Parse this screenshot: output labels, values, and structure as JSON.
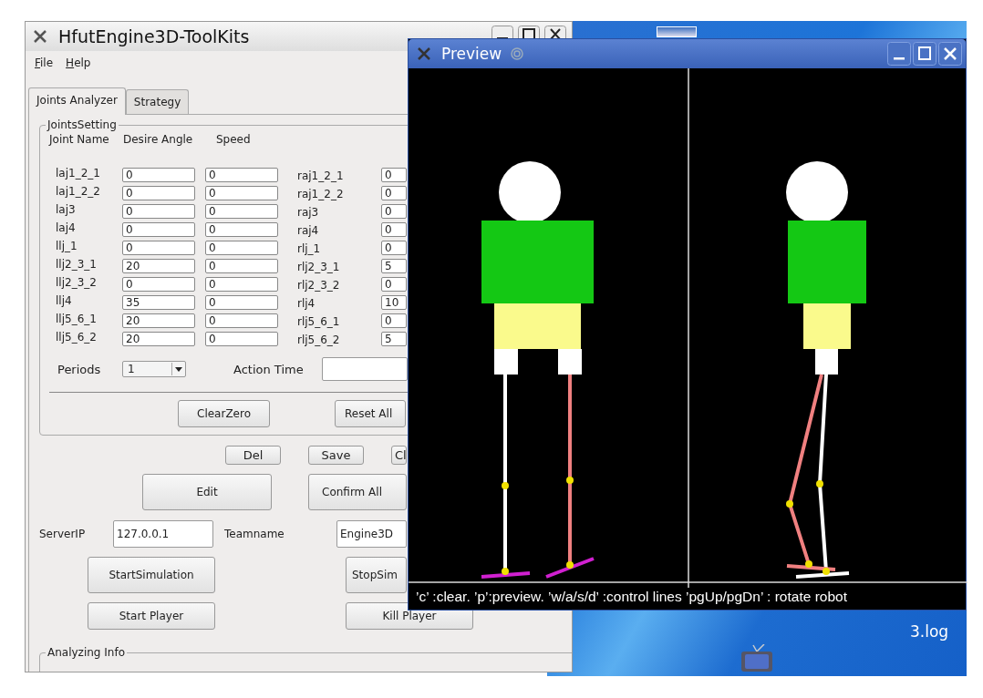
{
  "main_window": {
    "title": "HfutEngine3D-ToolKits",
    "menu": [
      "File",
      "Help"
    ],
    "tabs": [
      {
        "label": "Joints Analyzer",
        "selected": true
      },
      {
        "label": "Strategy",
        "selected": false
      }
    ],
    "joints_setting": {
      "title": "JointsSetting",
      "columns": [
        "Joint Name",
        "Desire Angle",
        "Speed"
      ],
      "rows": [
        {
          "name": "laj1_2_1",
          "angle": "0",
          "speed": "0",
          "right_name": "raj1_2_1",
          "right_value": "0"
        },
        {
          "name": "laj1_2_2",
          "angle": "0",
          "speed": "0",
          "right_name": "raj1_2_2",
          "right_value": "0"
        },
        {
          "name": "laj3",
          "angle": "0",
          "speed": "0",
          "right_name": "raj3",
          "right_value": "0"
        },
        {
          "name": "laj4",
          "angle": "0",
          "speed": "0",
          "right_name": "raj4",
          "right_value": "0"
        },
        {
          "name": "llj_1",
          "angle": "0",
          "speed": "0",
          "right_name": "rlj_1",
          "right_value": "0"
        },
        {
          "name": "llj2_3_1",
          "angle": "20",
          "speed": "0",
          "right_name": "rlj2_3_1",
          "right_value": "5"
        },
        {
          "name": "llj2_3_2",
          "angle": "0",
          "speed": "0",
          "right_name": "rlj2_3_2",
          "right_value": "0"
        },
        {
          "name": "llj4",
          "angle": "35",
          "speed": "0",
          "right_name": "rlj4",
          "right_value": "10"
        },
        {
          "name": "llj5_6_1",
          "angle": "20",
          "speed": "0",
          "right_name": "rlj5_6_1",
          "right_value": "0"
        },
        {
          "name": "llj5_6_2",
          "angle": "20",
          "speed": "0",
          "right_name": "rlj5_6_2",
          "right_value": "5"
        }
      ],
      "periods": {
        "label": "Periods",
        "value": "1"
      },
      "action_time": {
        "label": "Action Time"
      },
      "buttons": [
        "ClearZero",
        "Reset All"
      ]
    },
    "file_buttons": [
      "Del",
      "Save",
      "Cl"
    ],
    "big_buttons": [
      "Edit",
      "Confirm All"
    ],
    "server_ip": {
      "label": "ServerIP",
      "value": "127.0.0.1"
    },
    "teamname": {
      "label": "Teamname",
      "value": "Engine3D"
    },
    "sim_buttons": [
      "StartSimulation",
      "StopSim"
    ],
    "player_buttons": [
      "Start Player",
      "Kill Player"
    ],
    "analyzing_info": {
      "title": "Analyzing Info"
    }
  },
  "preview_window": {
    "title": "Preview",
    "help_text": "’c’ :clear. ’p’:preview. ’w/a/s/d’ :control lines ’pgUp/pgDn’ : rotate robot"
  },
  "desktop": {
    "icon_label": "3.log"
  }
}
